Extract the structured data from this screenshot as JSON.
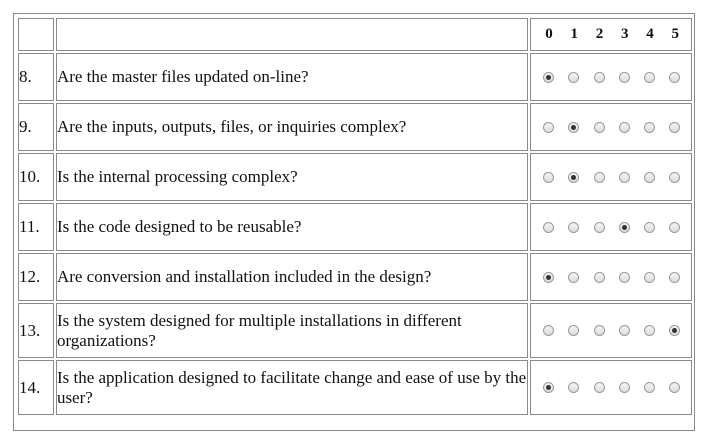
{
  "header": {
    "digits": [
      "0",
      "1",
      "2",
      "3",
      "4",
      "5"
    ]
  },
  "rows": [
    {
      "num": "8.",
      "question": "Are the master files updated on-line?",
      "selected": 0
    },
    {
      "num": "9.",
      "question": "Are the inputs, outputs, files, or inquiries complex?",
      "selected": 1
    },
    {
      "num": "10.",
      "question": "Is the internal processing complex?",
      "selected": 1
    },
    {
      "num": "11.",
      "question": "Is the code designed to be reusable?",
      "selected": 3
    },
    {
      "num": "12.",
      "question": "Are conversion and installation included in the design?",
      "selected": 0
    },
    {
      "num": "13.",
      "question": "Is the system designed for multiple installations in different organizations?",
      "selected": 5
    },
    {
      "num": "14.",
      "question": "Is the application designed to facilitate change and ease of use by the user?",
      "selected": 0
    }
  ]
}
